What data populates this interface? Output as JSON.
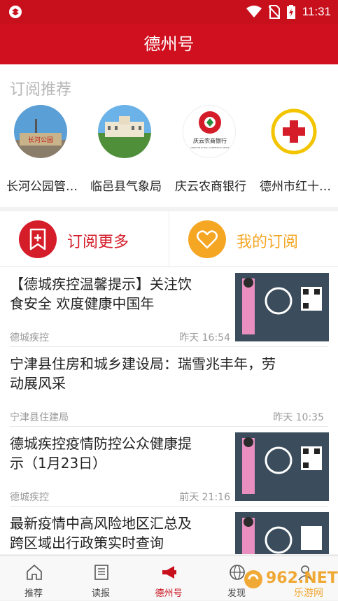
{
  "status_bar": {
    "time": "11:31"
  },
  "header": {
    "title": "德州号"
  },
  "recommend": {
    "title": "订阅推荐",
    "items": [
      {
        "label": "长河公园管…"
      },
      {
        "label": "临邑县气象局"
      },
      {
        "label": "庆云农商银行"
      },
      {
        "label": "德州市红十…"
      }
    ],
    "logo_text": {
      "park_sign": "长河公园",
      "bank_name": "庆云农商银行",
      "bank_sub": "QINGYUN RURAL COMMERCIAL BANK"
    }
  },
  "subscribe": {
    "more_label": "订阅更多",
    "mine_label": "我的订阅"
  },
  "news": [
    {
      "title_l1": "【德城疾控温馨提示】关注饮",
      "title_l2": "食安全 欢度健康中国年",
      "source": "德城疾控",
      "time": "昨天 16:54"
    },
    {
      "title_l1": "宁津县住房和城乡建设局：瑞雪兆丰年，劳",
      "title_l2": "动展风采",
      "source": "宁津县住建局",
      "time": "昨天 10:35"
    },
    {
      "title_l1": "德城疾控疫情防控公众健康提",
      "title_l2": "示（1月23日）",
      "source": "德城疾控",
      "time": "前天 21:16"
    },
    {
      "title_l1": "最新疫情中高风险地区汇总及",
      "title_l2": "跨区域出行政策实时查询",
      "source": "",
      "time": ""
    }
  ],
  "tabs": [
    {
      "label": "推荐"
    },
    {
      "label": "读报"
    },
    {
      "label": "德州号"
    },
    {
      "label": "发现"
    },
    {
      "label": ""
    }
  ],
  "watermark": {
    "text": "962.NET",
    "sub": "乐游网"
  },
  "colors": {
    "brand_red": "#d0101f",
    "accent_yellow": "#f5a623",
    "gray_text": "#9a9a9a"
  }
}
